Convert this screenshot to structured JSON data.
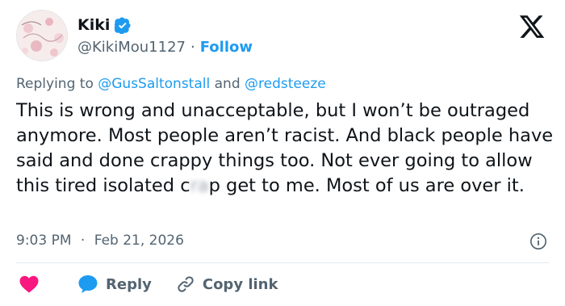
{
  "author": {
    "name": "Kiki",
    "handle": "@KikiMou1127",
    "follow_label": "Follow",
    "separator": "·",
    "verified_color": "#1d9bf0"
  },
  "reply_context": {
    "prefix": "Replying to",
    "mention_1": "@GusSaltonstall",
    "conjunction": "and",
    "mention_2": "@redsteeze"
  },
  "tweet": {
    "text_main": "This is wrong and unacceptable, but I won’t be outraged anymore. Most people aren’t racist. And black people have said and done crappy things too. Not ever going to allow this tired isolated c",
    "text_redacted": "ra",
    "text_after_redacted": "p get to me. Most of us are over it."
  },
  "meta": {
    "time": "9:03 PM",
    "separator": "·",
    "date": "Feb 21, 2026"
  },
  "actions": {
    "reply_label": "Reply",
    "copy_link_label": "Copy link"
  },
  "colors": {
    "accent": "#1d9bf0",
    "like": "#f91880",
    "muted": "#536471",
    "text": "#0f1419"
  },
  "icons": [
    "x-logo-icon",
    "verified-badge-icon",
    "info-icon",
    "heart-icon",
    "reply-bubble-icon",
    "link-icon"
  ]
}
